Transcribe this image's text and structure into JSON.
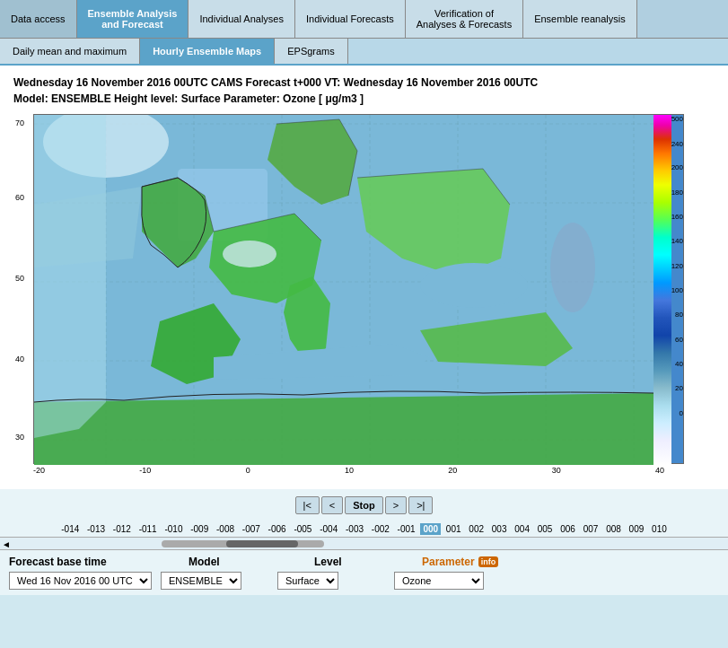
{
  "topNav": {
    "tabs": [
      {
        "id": "data-access",
        "label": "Data access",
        "active": false
      },
      {
        "id": "ensemble",
        "label": "Ensemble Analysis\nand Forecast",
        "active": true
      },
      {
        "id": "individual-analyses",
        "label": "Individual Analyses",
        "active": false
      },
      {
        "id": "individual-forecasts",
        "label": "Individual Forecasts",
        "active": false
      },
      {
        "id": "verification",
        "label": "Verification of\nAnalyses & Forecasts",
        "active": false
      },
      {
        "id": "ensemble-reanalysis",
        "label": "Ensemble reanalysis",
        "active": false
      }
    ]
  },
  "subNav": {
    "tabs": [
      {
        "id": "daily",
        "label": "Daily mean and maximum",
        "active": false
      },
      {
        "id": "hourly",
        "label": "Hourly Ensemble Maps",
        "active": true
      },
      {
        "id": "epsgrams",
        "label": "EPSgrams",
        "active": false
      }
    ]
  },
  "forecastTitle": {
    "line1": "Wednesday 16 November 2016 00UTC  CAMS Forecast t+000  VT: Wednesday 16 November 2016 00UTC",
    "line2": "Model: ENSEMBLE  Height level: Surface  Parameter: Ozone [ μg/m3 ]"
  },
  "map": {
    "alt": "CAMS Ensemble Ozone forecast map"
  },
  "colorScale": {
    "labels": [
      {
        "value": "500",
        "pct": 0
      },
      {
        "value": "240",
        "pct": 7
      },
      {
        "value": "200",
        "pct": 14
      },
      {
        "value": "180",
        "pct": 21
      },
      {
        "value": "160",
        "pct": 28
      },
      {
        "value": "140",
        "pct": 35
      },
      {
        "value": "120",
        "pct": 42
      },
      {
        "value": "100",
        "pct": 49
      },
      {
        "value": "80",
        "pct": 56
      },
      {
        "value": "60",
        "pct": 63
      },
      {
        "value": "40",
        "pct": 70
      },
      {
        "value": "20",
        "pct": 77
      },
      {
        "value": "0",
        "pct": 84
      }
    ]
  },
  "yAxisLabels": [
    {
      "value": "70",
      "pct": 2
    },
    {
      "value": "60",
      "pct": 25
    },
    {
      "value": "50",
      "pct": 47
    },
    {
      "value": "40",
      "pct": 68
    },
    {
      "value": "30",
      "pct": 90
    }
  ],
  "xAxisLabels": [
    "-20",
    "-10",
    "0",
    "10",
    "20",
    "30",
    "40"
  ],
  "controls": {
    "prevPrevBtn": "|<",
    "prevBtn": "<",
    "stopBtn": "Stop",
    "nextBtn": ">",
    "nextNextBtn": ">|"
  },
  "timeline": {
    "items": [
      {
        "label": "-014",
        "current": false
      },
      {
        "label": "-013",
        "current": false
      },
      {
        "label": "-012",
        "current": false
      },
      {
        "label": "-011",
        "current": false
      },
      {
        "label": "-010",
        "current": false
      },
      {
        "label": "-009",
        "current": false
      },
      {
        "label": "-008",
        "current": false
      },
      {
        "label": "-007",
        "current": false
      },
      {
        "label": "-006",
        "current": false
      },
      {
        "label": "-005",
        "current": false
      },
      {
        "label": "-004",
        "current": false
      },
      {
        "label": "-003",
        "current": false
      },
      {
        "label": "-002",
        "current": false
      },
      {
        "label": "-001",
        "current": false
      },
      {
        "label": "000",
        "current": true
      },
      {
        "label": "001",
        "current": false
      },
      {
        "label": "002",
        "current": false
      },
      {
        "label": "003",
        "current": false
      },
      {
        "label": "004",
        "current": false
      },
      {
        "label": "005",
        "current": false
      },
      {
        "label": "006",
        "current": false
      },
      {
        "label": "007",
        "current": false
      },
      {
        "label": "008",
        "current": false
      },
      {
        "label": "009",
        "current": false
      },
      {
        "label": "010",
        "current": false
      }
    ]
  },
  "bottomControls": {
    "forecastBaseTimeLabel": "Forecast base time",
    "modelLabel": "Model",
    "levelLabel": "Level",
    "parameterLabel": "Parameter",
    "forecastBaseTimeValue": "Wed 16 Nov 2016 00 UTC",
    "modelValue": "ENSEMBLE",
    "levelValue": "Surface",
    "parameterValue": "Ozone",
    "infoText": "info"
  }
}
